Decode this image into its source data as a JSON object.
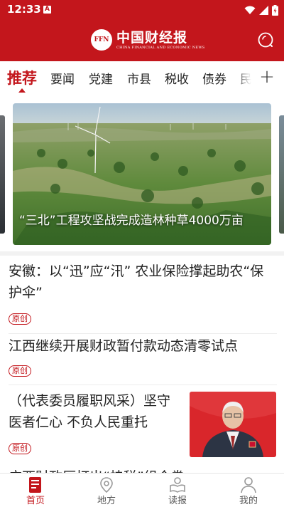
{
  "status": {
    "time": "12:33",
    "notification_letter": "A"
  },
  "header": {
    "logo_mark": "FFN",
    "logo_cn": "中国财经报",
    "logo_en": "CHINA FINANCIAL AND ECONOMIC NEWS",
    "brand_color": "#c3161c"
  },
  "tabs": [
    "推荐",
    "要闻",
    "党建",
    "市县",
    "税收",
    "债券",
    "民"
  ],
  "tabs_more": "+",
  "carousel": {
    "caption": "“三北”工程攻坚战完成造林种草4000万亩"
  },
  "news": [
    {
      "title": "安徽：以“迅”应“汛” 农业保险撑起助农“保护伞”",
      "tag": "原创"
    },
    {
      "title": "江西继续开展财政暂付款动态清零试点",
      "tag": "原创"
    },
    {
      "title": "（代表委员履职风采）坚守医者仁心 不负人民重托",
      "tag": "原创"
    }
  ],
  "peek_title": "广西财政厅打出“桂税”组合拳",
  "bottom_nav": [
    {
      "label": "首页",
      "icon": "newspaper-icon",
      "active": true
    },
    {
      "label": "地方",
      "icon": "map-pin-icon",
      "active": false
    },
    {
      "label": "读报",
      "icon": "reader-icon",
      "active": false
    },
    {
      "label": "我的",
      "icon": "user-icon",
      "active": false
    }
  ]
}
